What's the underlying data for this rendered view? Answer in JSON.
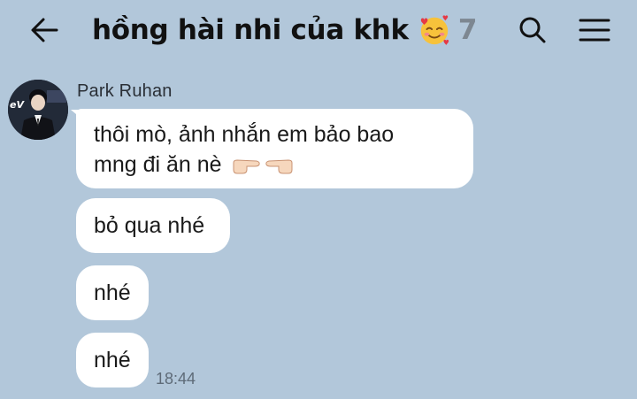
{
  "header": {
    "back_icon": "arrow-left-icon",
    "title": "hồng hài nhi của khk",
    "title_emoji": "smiling-face-with-hearts-icon",
    "member_count": "7",
    "search_icon": "search-icon",
    "menu_icon": "hamburger-menu-icon"
  },
  "chat": {
    "sender_name": "Park Ruhan",
    "messages": [
      {
        "line1": "thôi mò, ảnh nhắn em bảo bao",
        "line2": "mng đi ăn nè",
        "emojis": [
          "backhand-index-pointing-right-icon",
          "backhand-index-pointing-left-icon"
        ]
      },
      {
        "text": "bỏ qua nhé"
      },
      {
        "text": "nhé"
      },
      {
        "text": "nhé"
      }
    ],
    "timestamp": "18:44"
  },
  "colors": {
    "background": "#b2c7da",
    "bubble": "#ffffff",
    "member_count": "#7d8791"
  }
}
